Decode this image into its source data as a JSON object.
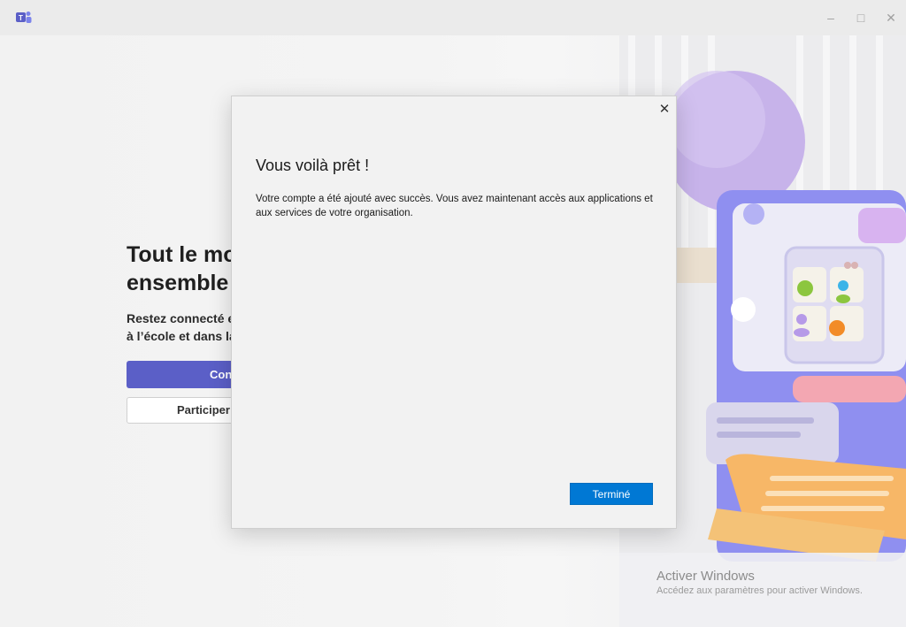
{
  "window": {
    "app_icon": "teams-icon",
    "controls": {
      "minimize_icon": "minimize-icon",
      "maximize_icon": "maximize-icon",
      "close_icon": "close-icon"
    }
  },
  "hero": {
    "title": "Tout le mo\nensemble",
    "subtitle": "Restez connecté et\nà l’école et dans la",
    "primary_button": "Con",
    "secondary_button": "Participer à"
  },
  "dialog": {
    "title": "Vous voilà prêt !",
    "body": "Votre compte a été ajouté avec succès. Vous avez maintenant accès aux applications et aux services de votre organisation.",
    "done_button": "Terminé",
    "close_icon": "close-icon"
  },
  "watermark": {
    "title": "Activer Windows",
    "subtitle": "Accédez aux paramètres pour activer Windows."
  },
  "colors": {
    "teams_purple": "#5b5fc7",
    "windows_blue": "#0078d4"
  }
}
